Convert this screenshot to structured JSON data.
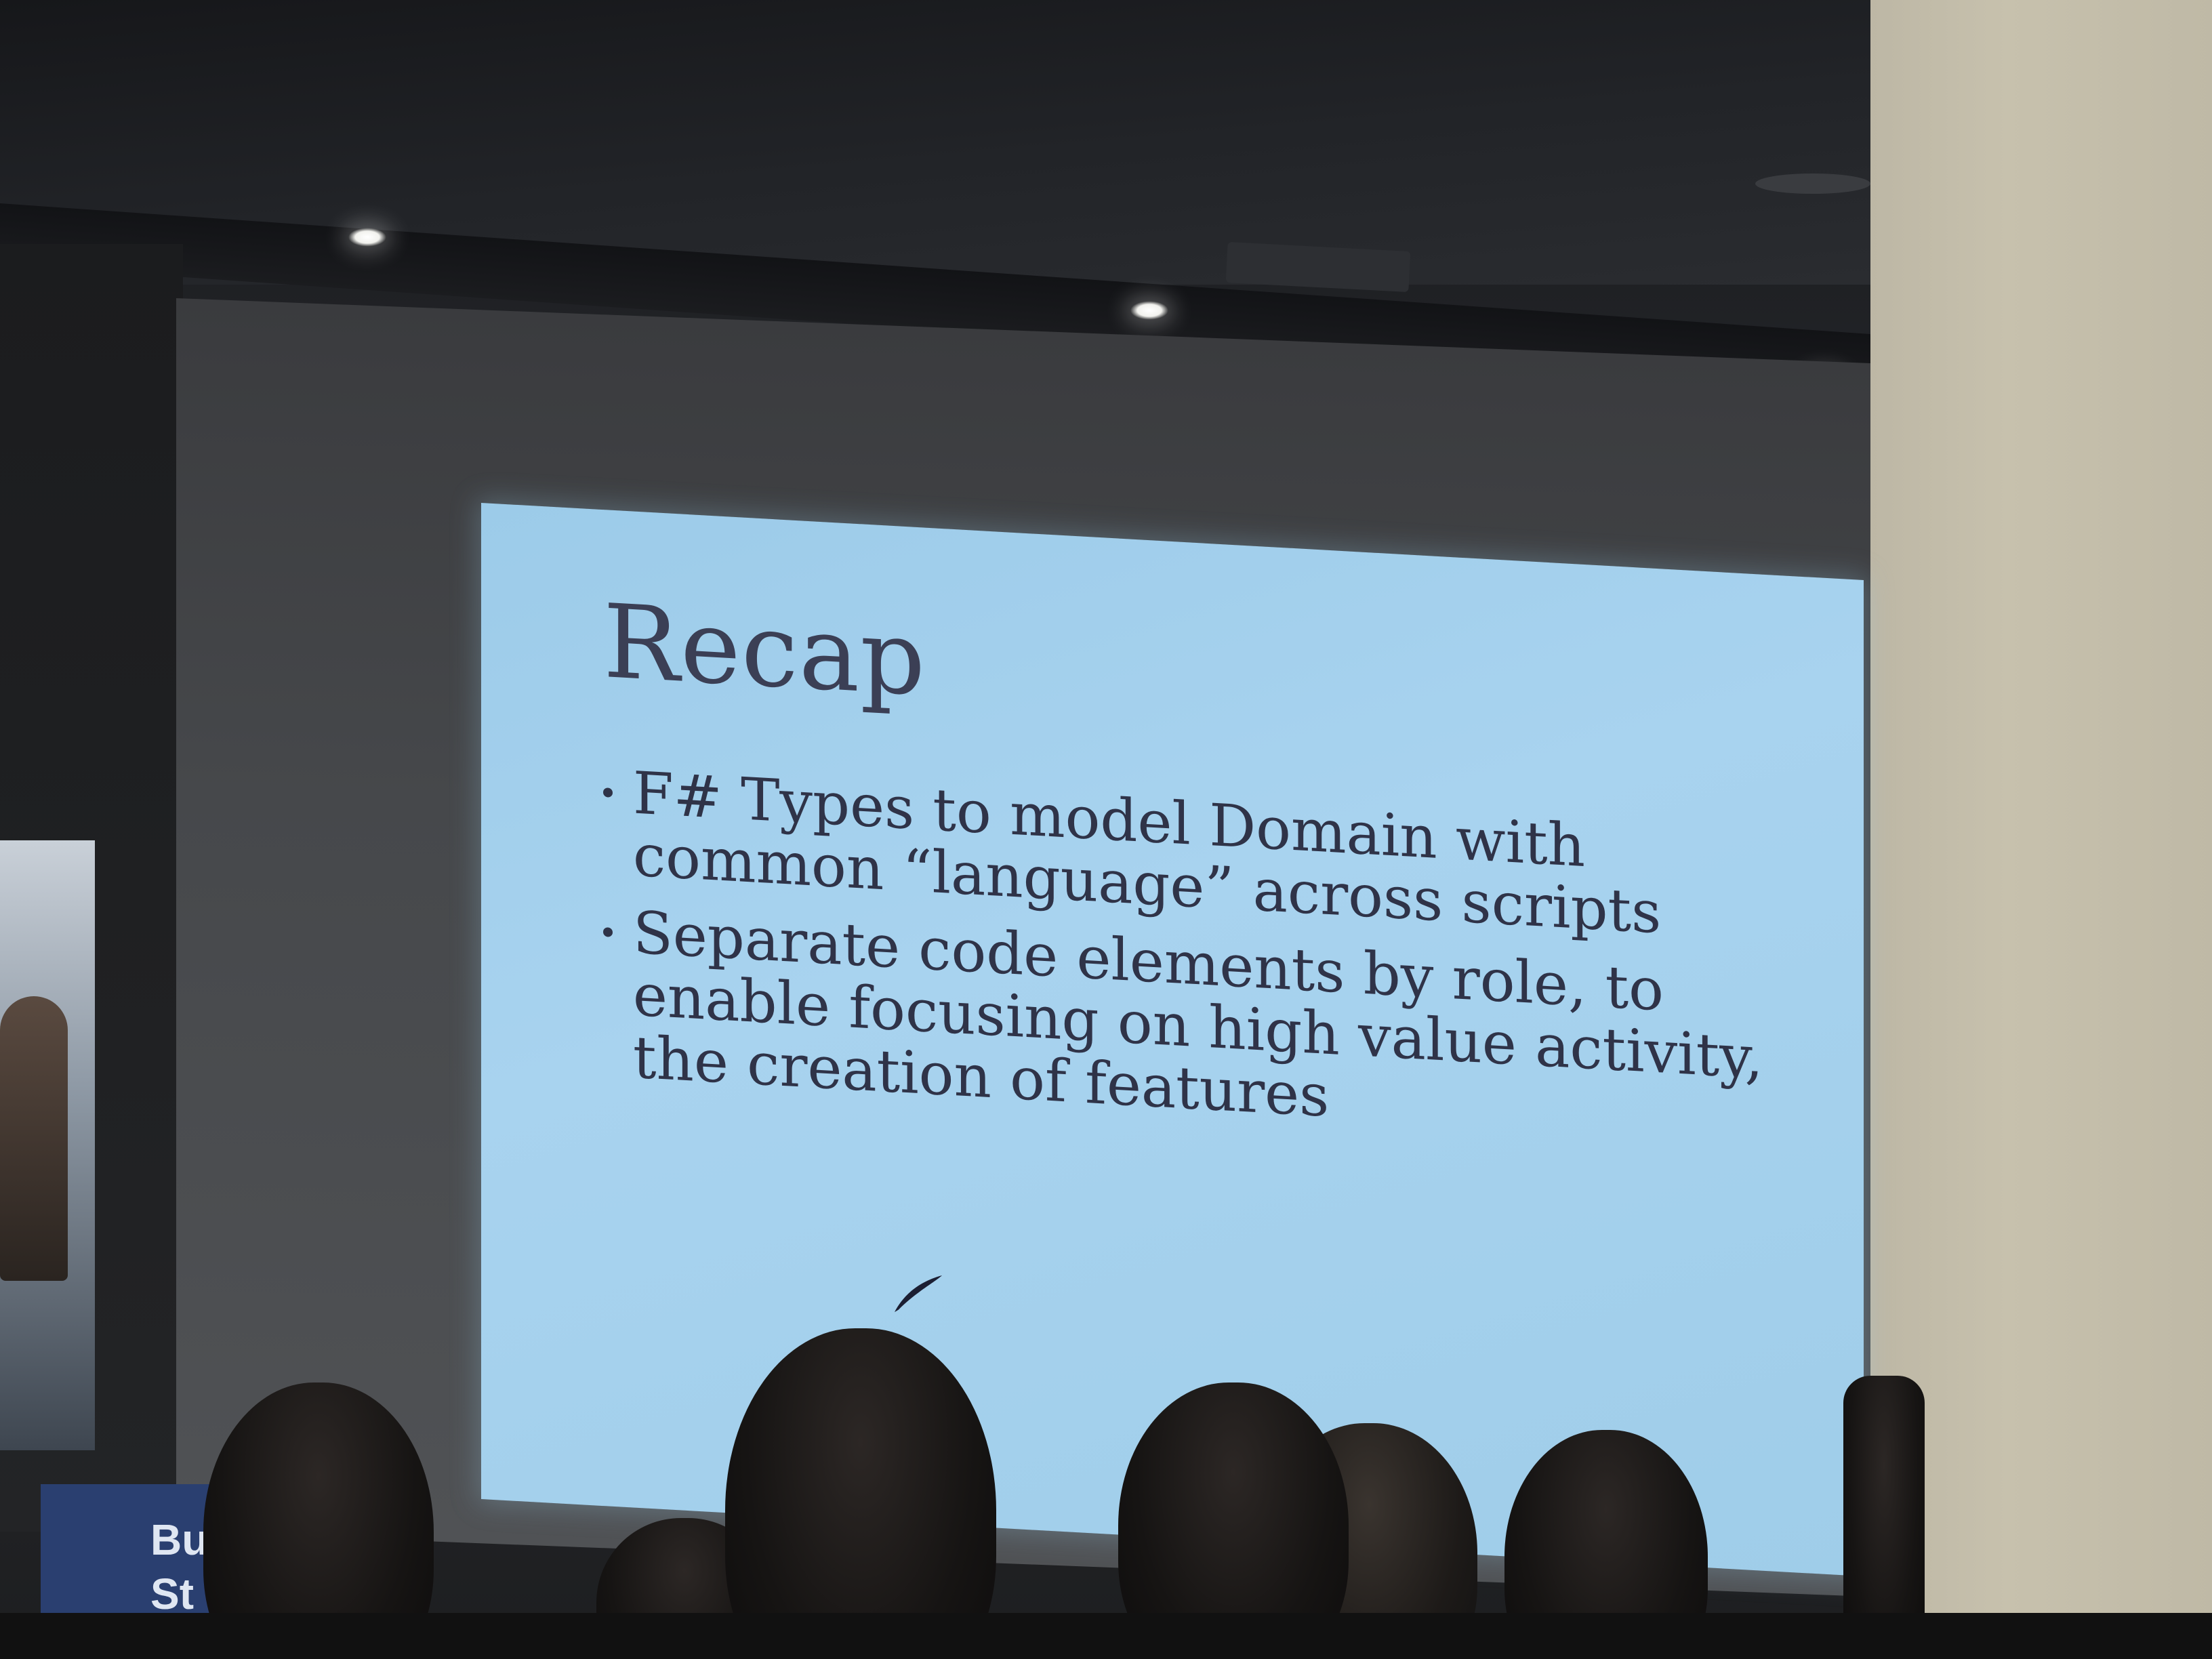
{
  "slide": {
    "title": "Recap",
    "bullets": [
      "F# Types to model Domain with common “language” across scripts",
      "Separate code elements by role, to enable focusing on high value activity, the creation of features"
    ]
  },
  "sign": {
    "line1": "Bu",
    "line2": "St"
  }
}
